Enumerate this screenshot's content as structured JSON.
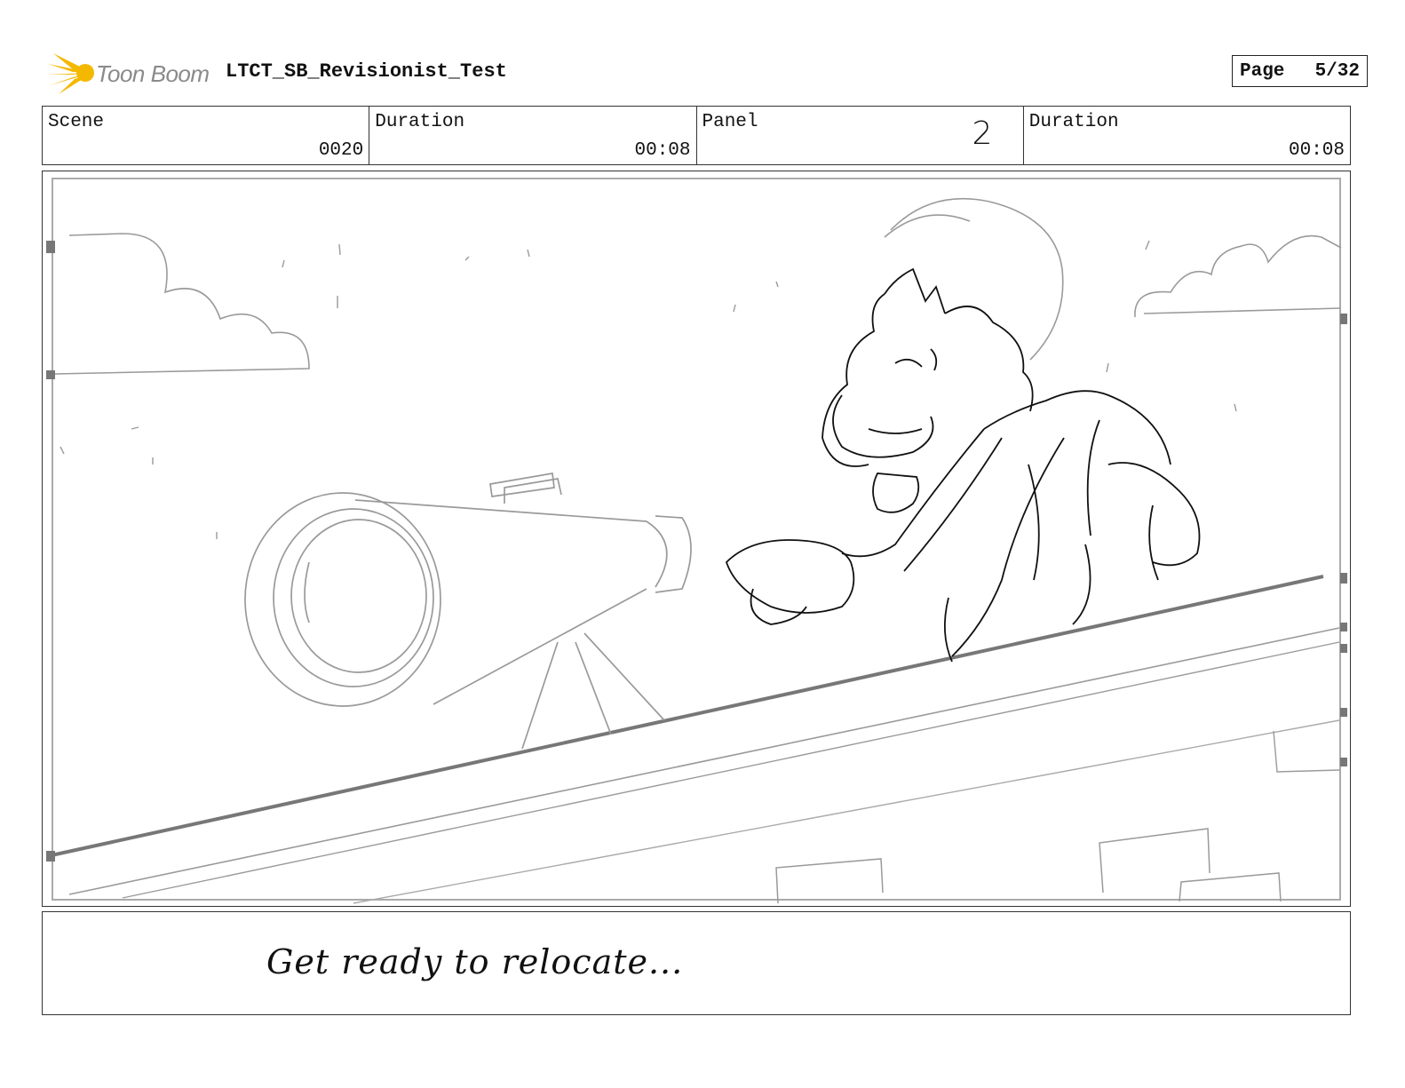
{
  "header": {
    "logo_text": "Toon Boom",
    "project_title": "LTCT_SB_Revisionist_Test",
    "page_label": "Page",
    "page_value": "5/32"
  },
  "info": {
    "scene_label": "Scene",
    "scene_value": "0020",
    "scene_duration_label": "Duration",
    "scene_duration_value": "00:08",
    "panel_label": "Panel",
    "panel_value": "2",
    "panel_duration_label": "Duration",
    "panel_duration_value": "00:08"
  },
  "caption": {
    "text": "Get ready to relocate..."
  },
  "colors": {
    "logo_yellow": "#f5b800",
    "sketch_light": "#9a9a9a",
    "sketch_dark": "#111111"
  }
}
